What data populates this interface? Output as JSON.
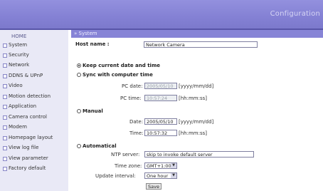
{
  "header": {
    "title": "Configuration"
  },
  "sidebar": {
    "home": "HOME",
    "items": [
      {
        "label": "System"
      },
      {
        "label": "Security"
      },
      {
        "label": "Network"
      },
      {
        "label": "DDNS & UPnP"
      },
      {
        "label": "Video"
      },
      {
        "label": "Motion detection"
      },
      {
        "label": "Application"
      },
      {
        "label": "Camera control"
      },
      {
        "label": "Modem"
      },
      {
        "label": "Homepage layout"
      },
      {
        "label": "View log file"
      },
      {
        "label": "View parameter"
      },
      {
        "label": "Factory default"
      }
    ]
  },
  "main": {
    "section_title": "» System",
    "host_name_label": "Host name :",
    "host_name_value": "Network Camera",
    "keep_label": "Keep current date and time",
    "sync_label": "Sync with computer time",
    "pc_date_label": "PC date:",
    "pc_date_value": "2005/05/10",
    "pc_date_format": "[yyyy/mm/dd]",
    "pc_time_label": "PC time:",
    "pc_time_value": "10:57:24",
    "pc_time_format": "[hh:mm:ss]",
    "manual_label": "Manual",
    "date_label": "Date:",
    "date_value": "2005/05/10",
    "date_format": "[yyyy/mm/dd]",
    "time_label": "Time:",
    "time_value": "10:57:32",
    "time_format": "[hh:mm:ss]",
    "auto_label": "Automatical",
    "ntp_label": "NTP server:",
    "ntp_value": "skip to invoke default server",
    "timezone_label": "Time zone:",
    "timezone_value": "GMT+1:00",
    "interval_label": "Update interval:",
    "interval_value": "One hour",
    "save_label": "Save"
  }
}
